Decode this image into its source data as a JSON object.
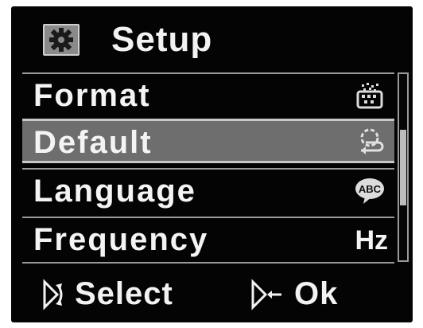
{
  "header": {
    "icon": "gear-icon",
    "title": "Setup"
  },
  "menu": {
    "items": [
      {
        "label": "Format",
        "icon": "format-icon",
        "selected": false
      },
      {
        "label": "Default",
        "icon": "reset-gear-icon",
        "selected": true
      },
      {
        "label": "Language",
        "icon": "abc-bubble-icon",
        "selected": false
      },
      {
        "label": "Frequency",
        "icon_text": "Hz",
        "selected": false
      }
    ]
  },
  "footer": {
    "select_hint": "Select",
    "ok_hint": "Ok"
  },
  "colors": {
    "background": "#040404",
    "selected": "#6e6e6e",
    "text": "#f2f2f2"
  }
}
